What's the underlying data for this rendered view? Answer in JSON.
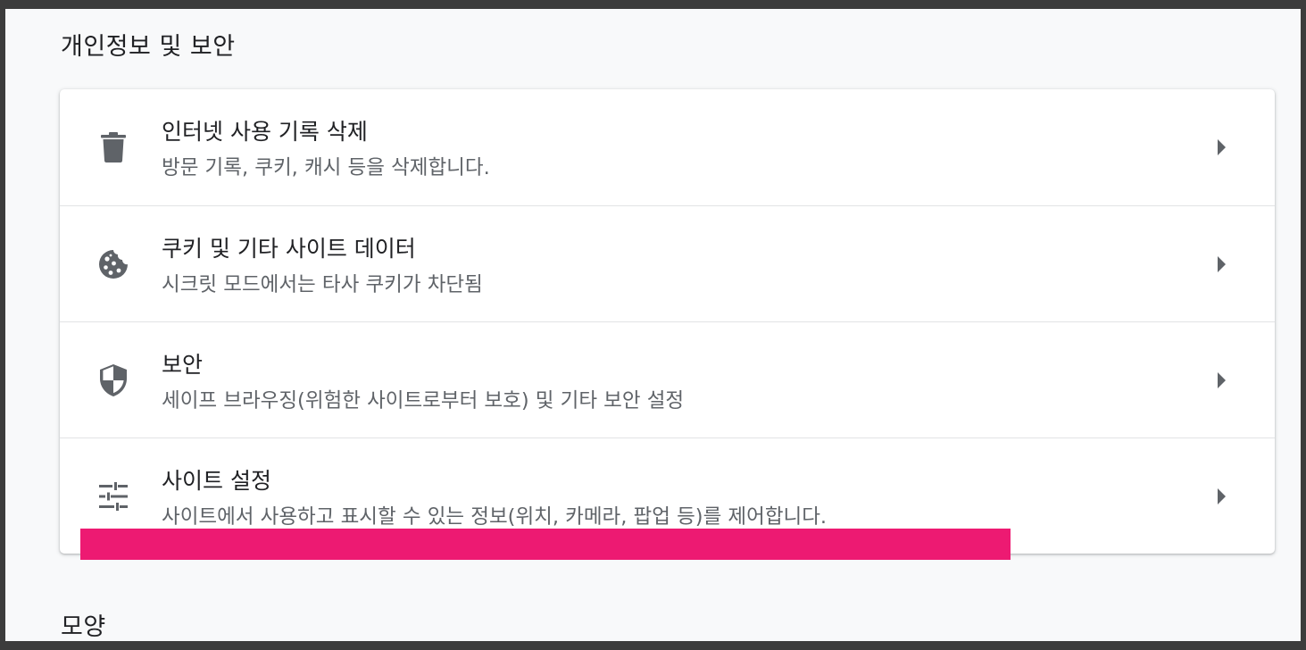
{
  "sections": {
    "privacy_title": "개인정보 및 보안",
    "appearance_title": "모양"
  },
  "rows": [
    {
      "title": "인터넷 사용 기록 삭제",
      "description": "방문 기록, 쿠키, 캐시 등을 삭제합니다.",
      "icon": "trash-icon"
    },
    {
      "title": "쿠키 및 기타 사이트 데이터",
      "description": "시크릿 모드에서는 타사 쿠키가 차단됨",
      "icon": "cookie-icon"
    },
    {
      "title": "보안",
      "description": "세이프 브라우징(위험한 사이트로부터 보호) 및 기타 보안 설정",
      "icon": "shield-icon"
    },
    {
      "title": "사이트 설정",
      "description": "사이트에서 사용하고 표시할 수 있는 정보(위치, 카메라, 팝업 등)를 제어합니다.",
      "icon": "tune-icon"
    }
  ],
  "colors": {
    "icon": "#5f6368",
    "arrow": "#5f6368",
    "highlight": "#ed1a72"
  }
}
